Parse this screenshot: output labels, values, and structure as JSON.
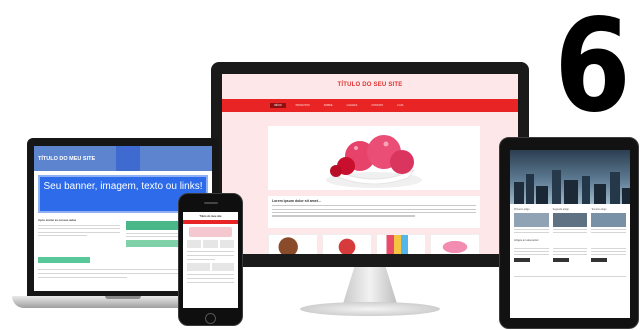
{
  "badge": {
    "number": "6"
  },
  "monitor": {
    "site_title": "TÍTULO DO SEU SITE",
    "nav_items": [
      "INÍCIO",
      "PRODUTOS",
      "SOBRE",
      "GALERIA",
      "CONTATO",
      "LOJA"
    ],
    "article_title": "Lorem ipsum dolor sit amet..."
  },
  "laptop": {
    "site_title": "TÍTULO DO MEU SITE",
    "nav_items": [
      "",
      "",
      "",
      ""
    ],
    "banner_text": "Seu banner, imagem, texto ou links!",
    "left_heading": "Após enviar as nossas aulas",
    "button_label": ""
  },
  "phone": {
    "site_title": "Título do meu site"
  },
  "tablet": {
    "columns": [
      "Primeiro artigo",
      "Segundo artigo",
      "Terceiro artigo"
    ],
    "section_title": "Artigos em elementor"
  },
  "colors": {
    "monitor_accent": "#e82424",
    "laptop_accent": "#2d6bea",
    "tablet_hero": "#2c3e50"
  }
}
